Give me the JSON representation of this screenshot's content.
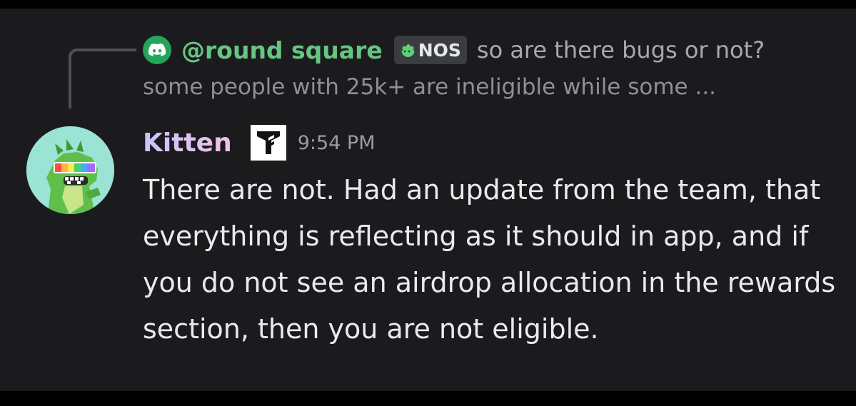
{
  "reply": {
    "author": "@round square",
    "author_color": "#67c583",
    "tag_label": "NOS",
    "preview_line1": "so are there bugs or not?",
    "preview_line2": "some people with 25k+ are ineligible while some ...",
    "avatar_icon": "discord-icon",
    "tag_icon": "clover-icon"
  },
  "message": {
    "username": "Kitten",
    "role_icon": "role-logo-icon",
    "timestamp": "9:54 PM",
    "text": "There are not. Had an update from the team, that everything is reflecting as it should in app, and if you do not see an airdrop allocation in the rewards section, then you are not eligible."
  },
  "colors": {
    "background": "#1b1b1e",
    "accent_green": "#23a55a"
  }
}
